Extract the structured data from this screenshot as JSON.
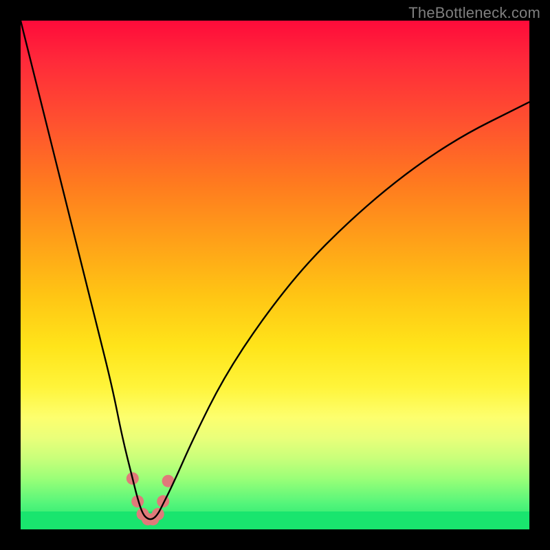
{
  "watermark": "TheBottleneck.com",
  "chart_data": {
    "type": "line",
    "title": "",
    "xlabel": "",
    "ylabel": "",
    "xlim": [
      0,
      100
    ],
    "ylim": [
      0,
      100
    ],
    "series": [
      {
        "name": "curve",
        "x": [
          0,
          3,
          6,
          9,
          12,
          15,
          18,
          20,
          22,
          23,
          24,
          25,
          26,
          27,
          28,
          30,
          34,
          40,
          48,
          56,
          64,
          72,
          80,
          88,
          96,
          100
        ],
        "values": [
          100,
          88,
          76,
          64,
          52,
          40,
          28,
          18,
          10,
          6,
          3,
          2,
          2,
          3,
          5,
          9,
          18,
          30,
          42,
          52,
          60,
          67,
          73,
          78,
          82,
          84
        ]
      }
    ],
    "markers": [
      {
        "x": 22.0,
        "y": 10.0
      },
      {
        "x": 23.0,
        "y": 5.5
      },
      {
        "x": 24.0,
        "y": 3.0
      },
      {
        "x": 25.0,
        "y": 2.0
      },
      {
        "x": 26.0,
        "y": 2.0
      },
      {
        "x": 27.0,
        "y": 3.0
      },
      {
        "x": 28.0,
        "y": 5.5
      },
      {
        "x": 29.0,
        "y": 9.5
      }
    ]
  }
}
